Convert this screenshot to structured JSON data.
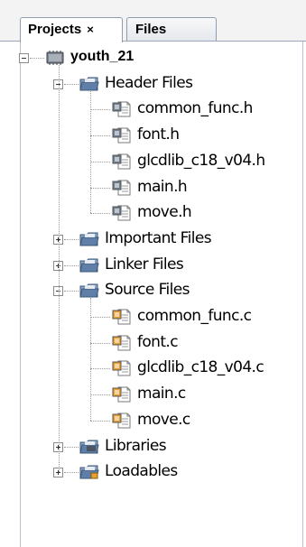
{
  "tabs": [
    {
      "label": "Projects",
      "close_glyph": "×",
      "active": true
    },
    {
      "label": "Files",
      "active": false
    }
  ],
  "tree": {
    "project": {
      "label": "youth_21",
      "icon": "chip-icon",
      "expanded": true
    },
    "groups": [
      {
        "label": "Header Files",
        "expanded": true,
        "icon": "folder-icon",
        "items": [
          {
            "label": "common_func.h",
            "icon": "header-file-icon"
          },
          {
            "label": "font.h",
            "icon": "header-file-icon"
          },
          {
            "label": "glcdlib_c18_v04.h",
            "icon": "header-file-icon"
          },
          {
            "label": "main.h",
            "icon": "header-file-icon"
          },
          {
            "label": "move.h",
            "icon": "header-file-icon"
          }
        ]
      },
      {
        "label": "Important Files",
        "expanded": false,
        "icon": "folder-icon",
        "items": []
      },
      {
        "label": "Linker Files",
        "expanded": false,
        "icon": "folder-icon",
        "items": []
      },
      {
        "label": "Source Files",
        "expanded": true,
        "icon": "folder-icon",
        "items": [
          {
            "label": "common_func.c",
            "icon": "c-source-file-icon"
          },
          {
            "label": "font.c",
            "icon": "c-source-file-icon"
          },
          {
            "label": "glcdlib_c18_v04.c",
            "icon": "c-source-file-icon"
          },
          {
            "label": "main.c",
            "icon": "c-source-file-icon"
          },
          {
            "label": "move.c",
            "icon": "c-source-file-icon"
          }
        ]
      },
      {
        "label": "Libraries",
        "expanded": false,
        "icon": "library-folder-icon",
        "items": []
      },
      {
        "label": "Loadables",
        "expanded": false,
        "icon": "loadables-folder-icon",
        "items": []
      }
    ]
  },
  "colors": {
    "folder": "#5f7fa8",
    "header_file_accent": "#6f7f8f",
    "c_source_accent": "#e8a030",
    "tab_border": "#8f9db1"
  }
}
